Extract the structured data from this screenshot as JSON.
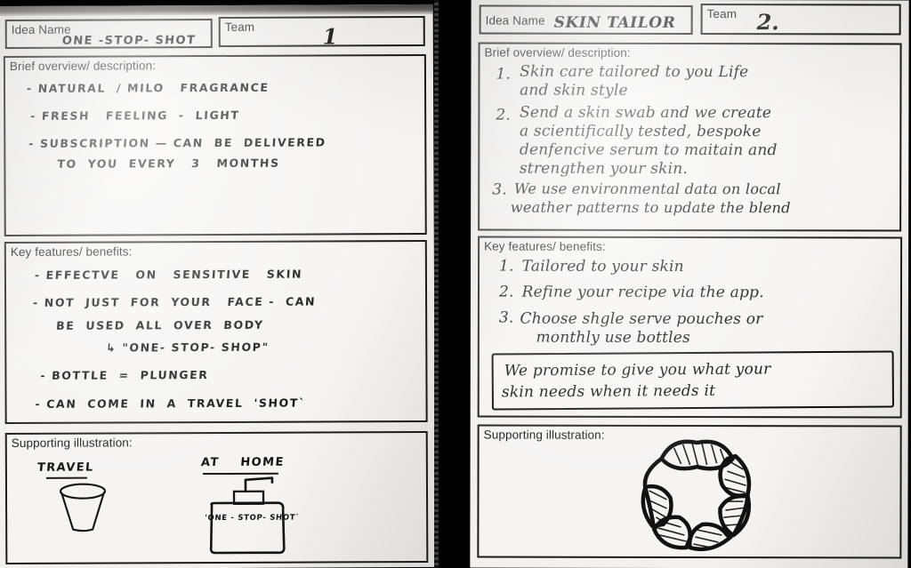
{
  "scene": {
    "description": "Two photographed paper idea-sheets side by side on a dark background",
    "divider_color": "#000000",
    "paper_color": "#f2f1ef",
    "ink_color": "#111111"
  },
  "form_labels": {
    "idea_name": "Idea Name",
    "team": "Team",
    "brief_overview": "Brief overview/ description:",
    "key_features": "Key features/ benefits:",
    "supporting_illustration": "Supporting illustration:"
  },
  "sheets": [
    {
      "id": "left",
      "idea_name_value": "ONE -STOP- SHOT",
      "team_value": "1",
      "brief_overview_lines": [
        "- NATURAL  / MILO   FRAGRANCE",
        "- FRESH   FEELING  -  LIGHT",
        "- SUBSCRIPTION — CAN  BE  DELIVERED",
        "TO  YOU  EVERY   3   MONTHS"
      ],
      "key_features_lines": [
        "- EFFECTVE   ON   SENSITIVE   SKIN",
        "- NOT  JUST  FOR  YOUR   FACE -  CAN",
        "BE  USED  ALL  OVER  BODY",
        "↳ \"ONE- STOP- SHOP\"",
        "- BOTTLE  =  PLUNGER",
        "- CAN  COME  IN  A  TRAVEL  'SHOT`"
      ],
      "illustration": {
        "caption_left": "TRAVEL",
        "caption_right": "AT    HOME",
        "bottle_label": "'ONE - STOP- SHOT`",
        "sketches": [
          "travel-cup-sketch",
          "pump-bottle-sketch"
        ]
      }
    },
    {
      "id": "right",
      "idea_name_value": "SKIN TAILOR",
      "team_value": "2.",
      "brief_overview_items": [
        {
          "num": "1.",
          "lines": [
            "Skin care tailored to you Life",
            "and skin style"
          ]
        },
        {
          "num": "2.",
          "lines": [
            "Send a skin swab and we create",
            "a scientifically tested, bespoke",
            "denfencive serum to maitain and",
            "strengthen your skin."
          ]
        },
        {
          "num": "3.",
          "lines": [
            "We use environmental data on local",
            "weather patterns to update the blend"
          ]
        }
      ],
      "key_features_items": [
        {
          "num": "1.",
          "lines": [
            "Tailored to your skin"
          ]
        },
        {
          "num": "2.",
          "lines": [
            "Refine your recipe via the app."
          ]
        },
        {
          "num": "3.",
          "lines": [
            "Choose shgle serve pouches or",
            "monthly use bottles"
          ]
        }
      ],
      "promise_lines": [
        "We promise to give you what your",
        "skin needs when it needs it"
      ],
      "illustration": {
        "sketches": [
          "hatched-star-flower-sketch"
        ]
      }
    }
  ]
}
